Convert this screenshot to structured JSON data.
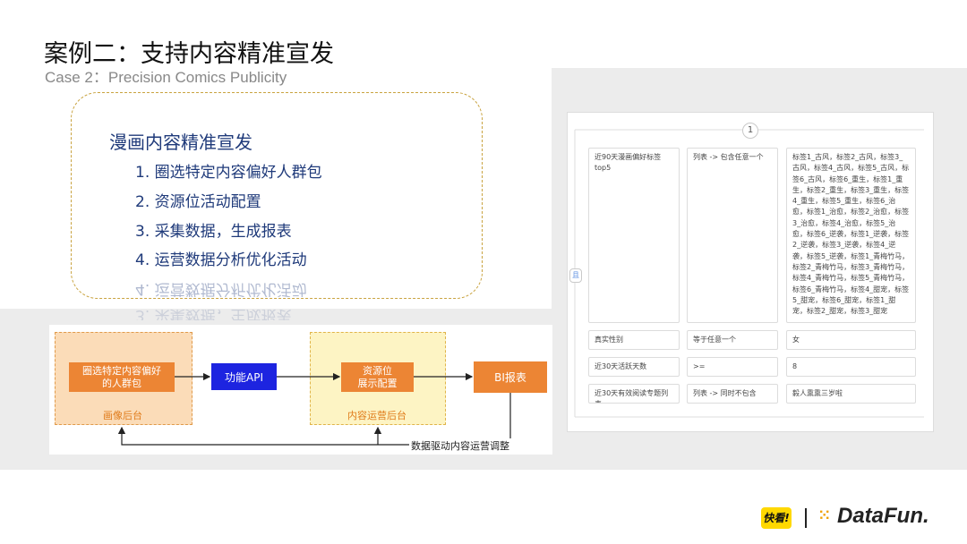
{
  "header": {
    "title": "案例二：支持内容精准宣发",
    "subtitle": "Case 2：Precision Comics Publicity"
  },
  "summary_box": {
    "heading": "漫画内容精准宣发",
    "steps": [
      "1. 圈选特定内容偏好人群包",
      "2. 资源位活动配置",
      "3. 采集数据，生成报表",
      "4. 运营数据分析优化活动"
    ]
  },
  "flow": {
    "zone_left_label": "画像后台",
    "zone_mid_label": "内容运营后台",
    "node_crowd": "圈选特定内容偏好\n的人群包",
    "node_api": "功能API",
    "node_resource": "资源位\n展示配置",
    "node_bi": "BI报表",
    "feedback_label": "数据驱动内容运营调整",
    "colors": {
      "orange": "#ec8534",
      "blue": "#1d24e0",
      "zone_left": "#fbdcb8",
      "zone_mid": "#fdf4c4"
    }
  },
  "form": {
    "page_number": "1",
    "side_marker": "且",
    "rows": [
      {
        "field": "近90天漫画偏好标签top5",
        "operator": "列表 -> 包含任意一个",
        "value": "标签1_古风，标签2_古风，标签3_古风，标签4_古风，标签5_古风，标签6_古风，标签6_重生，标签1_重生，标签2_重生，标签3_重生，标签4_重生，标签5_重生，标签6_治愈，标签1_治愈，标签2_治愈，标签3_治愈，标签4_治愈，标签5_治愈，标签6_逆袭，标签1_逆袭，标签2_逆袭，标签3_逆袭，标签4_逆袭，标签5_逆袭，标签1_青梅竹马，标签2_青梅竹马，标签3_青梅竹马，标签4_青梅竹马，标签5_青梅竹马，标签6_青梅竹马，标签4_甜宠，标签5_甜宠，标签6_甜宠，标签1_甜宠，标签2_甜宠，标签3_甜宠"
      },
      {
        "field": "真实性别",
        "operator": "等于任意一个",
        "value": "女"
      },
      {
        "field": "近30天活跃天数",
        "operator": ">=",
        "value": "8"
      },
      {
        "field": "近30天有效阅读专题列表",
        "operator": "列表 -> 同时不包含",
        "value": "毅人熏熏三岁啦"
      }
    ]
  },
  "logos": {
    "left": "快看!",
    "right": "DataFun."
  }
}
